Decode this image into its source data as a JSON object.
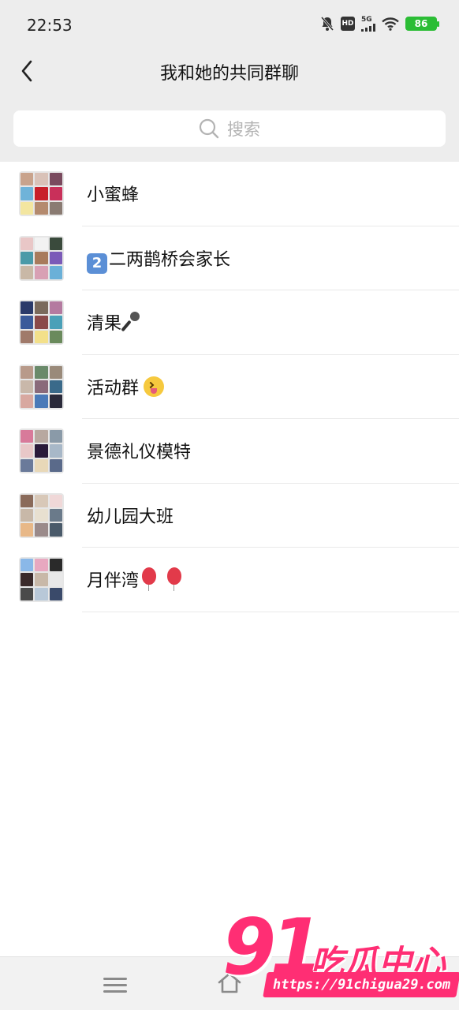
{
  "status_bar": {
    "time": "22:53",
    "network": "5G",
    "hd_badge": "HD",
    "battery": "86",
    "icons": [
      "mute-bell-icon",
      "hd-icon",
      "5g-signal-icon",
      "wifi-icon",
      "battery-icon"
    ]
  },
  "header": {
    "title": "我和她的共同群聊",
    "back_icon": "chevron-left-icon"
  },
  "search": {
    "placeholder": "搜索",
    "icon": "search-icon"
  },
  "groups": [
    {
      "name": "小蜜蜂",
      "emoji": ""
    },
    {
      "name": "二两鹊桥会家长",
      "emoji": "keycap-2"
    },
    {
      "name": "清果",
      "emoji": "microphone"
    },
    {
      "name": "活动群",
      "emoji": "squinting-tongue-face"
    },
    {
      "name": "景德礼仪模特",
      "emoji": ""
    },
    {
      "name": "幼儿园大班",
      "emoji": ""
    },
    {
      "name": "月伴湾",
      "emoji": "balloon balloon"
    }
  ],
  "emoji_text": {
    "keycap_2": "2"
  },
  "bottom_nav": {
    "icons": [
      "menu-icon",
      "home-icon",
      "back-triangle-icon"
    ]
  },
  "watermark": {
    "number": "91",
    "text": "吃瓜中心",
    "url": "https://91chigua29.com"
  },
  "colors": {
    "header_bg": "#ededed",
    "list_bg": "#ffffff",
    "watermark_pink": "#ff2e74",
    "battery_green": "#2bbd35"
  }
}
